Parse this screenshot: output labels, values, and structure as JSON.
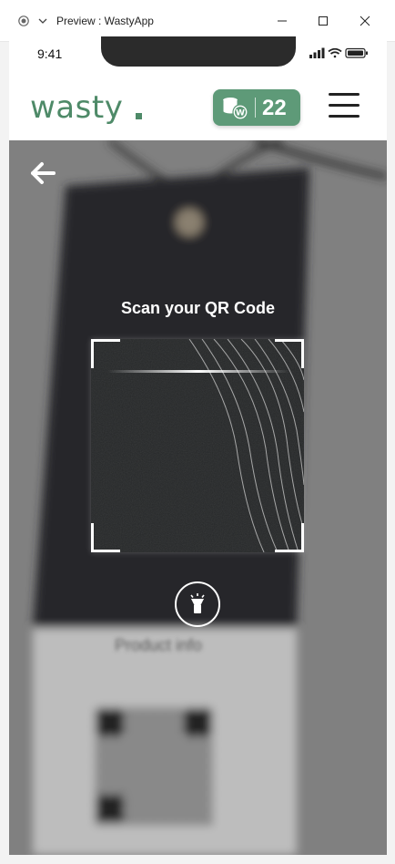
{
  "window": {
    "title": "Preview : WastyApp",
    "icons": [
      "record-icon",
      "chevron-down-icon",
      "minimize-icon",
      "maximize-icon",
      "close-icon"
    ]
  },
  "status_bar": {
    "time": "9:41",
    "icons": [
      "signal-icon",
      "wifi-icon",
      "battery-icon"
    ]
  },
  "header": {
    "logo": "wasty",
    "coin_count": "22",
    "coin_icon": "coins-icon",
    "menu_icon": "hamburger-menu-icon"
  },
  "scanner": {
    "title": "Scan your QR Code",
    "back_icon": "back-arrow-icon",
    "torch_icon": "flashlight-icon"
  },
  "background_tag": {
    "label": "Product info"
  },
  "colors": {
    "brand_green": "#4e8a68",
    "badge_green": "#5e9a78",
    "overlay": "#7f7f7f"
  }
}
